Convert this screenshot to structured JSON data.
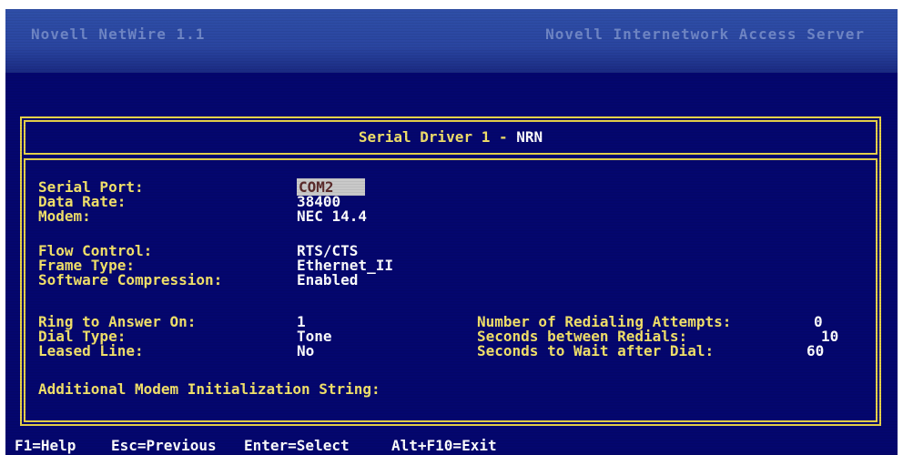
{
  "window": {
    "title_left": "Novell NetWire 1.1",
    "title_right": "Novell Internetwork Access Server"
  },
  "panel": {
    "title_prefix": "Serial Driver 1 - ",
    "title_name": "NRN"
  },
  "fields": {
    "serial_port": {
      "label": "Serial Port:",
      "value": "COM2"
    },
    "data_rate": {
      "label": "Data Rate:",
      "value": "38400"
    },
    "modem": {
      "label": "Modem:",
      "value": "NEC 14.4"
    },
    "flow_control": {
      "label": "Flow Control:",
      "value": "RTS/CTS"
    },
    "frame_type": {
      "label": "Frame Type:",
      "value": "Ethernet_II"
    },
    "software_compression": {
      "label": "Software Compression:",
      "value": "Enabled"
    },
    "ring_to_answer_on": {
      "label": "Ring to Answer On:",
      "value": "1"
    },
    "dial_type": {
      "label": "Dial Type:",
      "value": "Tone"
    },
    "leased_line": {
      "label": "Leased Line:",
      "value": "No"
    },
    "redial_attempts": {
      "label": "Number of Redialing Attempts:",
      "value": "0"
    },
    "seconds_between_redials": {
      "label": "Seconds between Redials:",
      "value": "10"
    },
    "seconds_to_wait": {
      "label": "Seconds to Wait after Dial:",
      "value": "60"
    },
    "init_string": {
      "label": "Additional Modem Initialization String:",
      "value": ""
    }
  },
  "status_bar": {
    "help": "F1=Help",
    "previous": "Esc=Previous",
    "select": "Enter=Select",
    "exit": "Alt+F10=Exit"
  },
  "colors": {
    "background": "#04066e",
    "label": "#f2e16a",
    "value": "#ffffff",
    "border": "#e8d24a",
    "highlight": "#c9c9c9"
  }
}
